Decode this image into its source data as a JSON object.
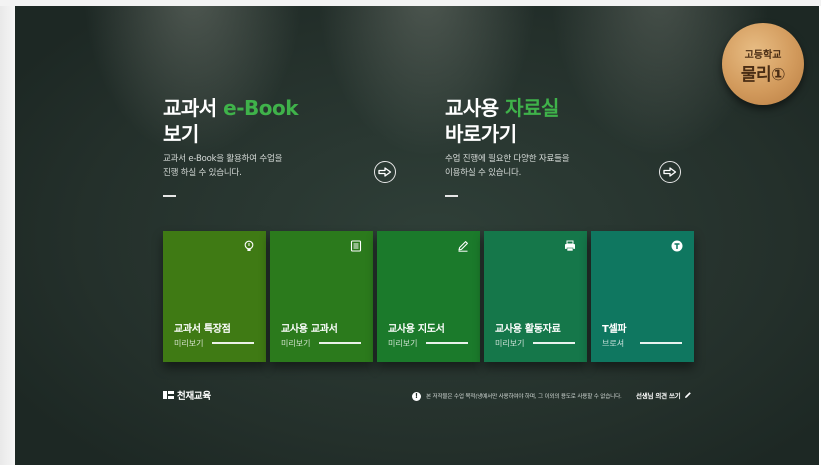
{
  "ebook_panel": {
    "title_prefix": "교과서 ",
    "title_highlight": "e-Book",
    "title_line2": "보기",
    "desc_line1": "교과서 e-Book을 활용하여 수업을",
    "desc_line2": "진행 하실 수 있습니다."
  },
  "resource_panel": {
    "title_prefix": "교사용 ",
    "title_highlight": "자료실",
    "title_line2": "바로가기",
    "desc_line1": "수업 진행에 필요한 다양한 자료들을",
    "desc_line2": "이용하실 수 있습니다."
  },
  "badge": {
    "line1": "고등학교",
    "line2": "물리①"
  },
  "cards": [
    {
      "title": "교과서 특장점",
      "sub": "미리보기",
      "icon": "lightbulb-icon",
      "color": "#3f7a14"
    },
    {
      "title": "교사용 교과서",
      "sub": "미리보기",
      "icon": "book-icon",
      "color": "#2b7a1c"
    },
    {
      "title": "교사용 지도서",
      "sub": "미리보기",
      "icon": "pencil-icon",
      "color": "#1b7a2b"
    },
    {
      "title": "교사용 활동자료",
      "sub": "미리보기",
      "icon": "printer-icon",
      "color": "#15774a"
    },
    {
      "title": "T셀파",
      "sub": "브로셔",
      "icon": "t-logo-icon",
      "color": "#0f7760"
    }
  ],
  "footer": {
    "logo_text": "천재교육",
    "info_mark": "!",
    "notice": "본 저작물은 수업 목적(냉예서만 사용하여야 하며, 그 이외의 용도로 사용할 수 없습니다.",
    "opinion": "선생님 의견 쓰기"
  }
}
